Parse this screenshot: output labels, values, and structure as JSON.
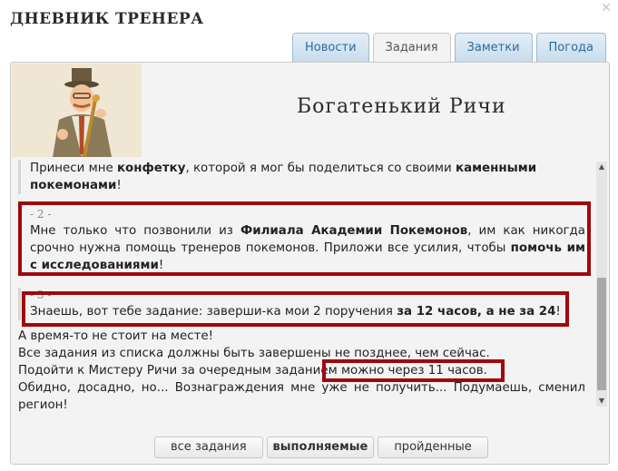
{
  "window": {
    "title": "Дневник тренера"
  },
  "tabs": [
    {
      "label": "Новости"
    },
    {
      "label": "Задания"
    },
    {
      "label": "Заметки"
    },
    {
      "label": "Погода"
    }
  ],
  "npc": {
    "name": "Богатенький Ричи"
  },
  "quest": {
    "intro": [
      "Принеси мне ",
      "конфетку",
      ", которой я мог бы поделиться со своими ",
      "каменными покемонами",
      "!"
    ],
    "steps": [
      {
        "number": "- 2 -",
        "parts": [
          "Мне только что позвонили из ",
          "Филиала Академии Покемонов",
          ", им как никогда срочно нужна помощь тренеров покемонов. Приложи все усилия, чтобы ",
          "помочь им с исследованиями",
          "!"
        ]
      },
      {
        "number": "- 3 -",
        "parts": [
          "Знаешь, вот тебе задание: заверши-ка мои 2 поручения ",
          "за 12 часов, а не за 24",
          "!"
        ]
      }
    ],
    "status": [
      "А время-то не стоит на месте!",
      "Все задания из списка должны быть завершены не позднее, чем сейчас.",
      "Подойти к Мистеру Ричи за очередным заданием",
      " можно через 11 часов.",
      "Обидно, досадно, но... Вознаграждения мне уже не получить... Подумаешь, сменил регион!"
    ]
  },
  "filters": [
    {
      "label": "все задания"
    },
    {
      "label": "выполняемые"
    },
    {
      "label": "пройденные"
    }
  ],
  "colors": {
    "highlight": "#a0070c",
    "tab_text": "#2c6aa0"
  }
}
